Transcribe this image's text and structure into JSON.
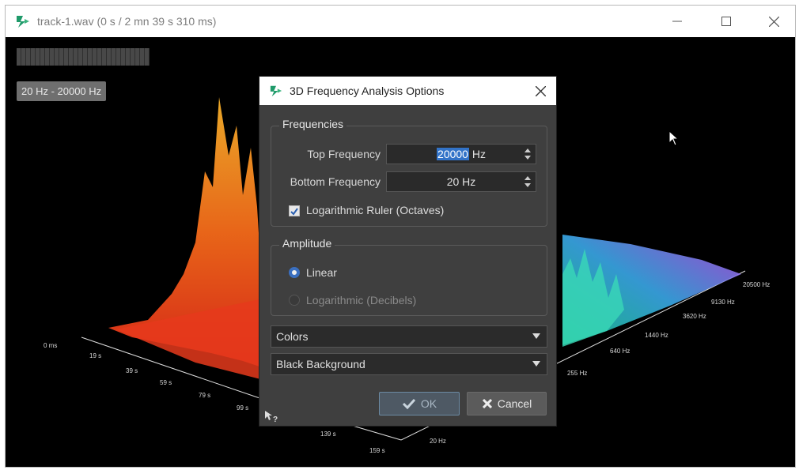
{
  "window": {
    "title": "track-1.wav (0 s / 2 mn 39 s 310 ms)",
    "controls": {
      "minimize": "minimize-icon",
      "maximize": "maximize-icon",
      "close": "close-icon"
    }
  },
  "view": {
    "range_badge": "20 Hz - 20000 Hz",
    "time_ticks": [
      "0 ms",
      "19 s",
      "39 s",
      "59 s",
      "79 s",
      "99 s",
      "139 s",
      "159 s"
    ],
    "freq_ticks": [
      "20 Hz",
      "255 Hz",
      "640 Hz",
      "1440 Hz",
      "3620 Hz",
      "9130 Hz",
      "20500 Hz"
    ]
  },
  "dialog": {
    "title": "3D Frequency Analysis Options",
    "frequencies": {
      "legend": "Frequencies",
      "top_label": "Top Frequency",
      "top_value": "20000",
      "top_unit": " Hz",
      "bottom_label": "Bottom Frequency",
      "bottom_value": "20 Hz",
      "log_ruler_label": "Logarithmic Ruler (Octaves)",
      "log_ruler_checked": true
    },
    "amplitude": {
      "legend": "Amplitude",
      "linear_label": "Linear",
      "log_label": "Logarithmic (Decibels)",
      "selected": "Linear"
    },
    "colors_dropdown": "Colors",
    "background_dropdown": "Black Background",
    "ok_label": "OK",
    "cancel_label": "Cancel"
  },
  "colors": {
    "accent": "#3273c8",
    "dialog_bg": "#3f3f3f",
    "background": "#000000"
  }
}
